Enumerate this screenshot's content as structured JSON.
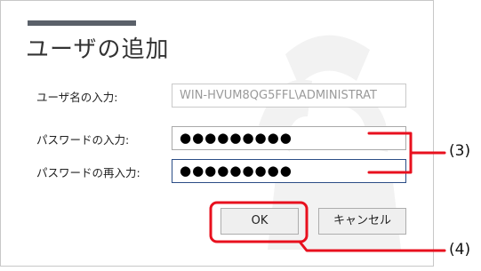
{
  "dialog": {
    "title": "ユーザの追加",
    "username_label": "ユーザ名の入力:",
    "username_value": "WIN-HVUM8QG5FFL\\ADMINISTRAT",
    "password_label": "パスワードの入力:",
    "password_value": "●●●●●●●●●",
    "password_confirm_label": "パスワードの再入力:",
    "password_confirm_value": "●●●●●●●●●",
    "ok_label": "OK",
    "cancel_label": "キャンセル"
  },
  "annotations": {
    "callout_3": "(3)",
    "callout_4": "(4)",
    "highlight_color": "#e8101e"
  }
}
